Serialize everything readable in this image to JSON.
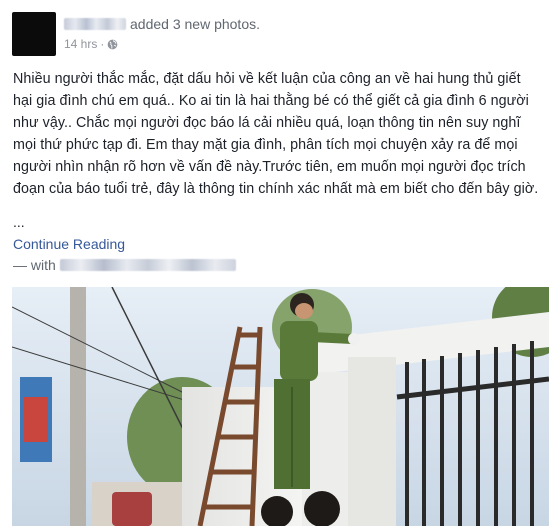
{
  "post": {
    "action_text": "added 3 new photos.",
    "time": "14 hrs",
    "separator": "·",
    "body": "Nhiều người thắc mắc, đặt dấu hỏi về kết luận của công an về hai hung thủ giết hại gia đình chú em quá.. Ko ai tin là hai thằng bé có thể giết cả gia đình 6 người như vậy.. Chắc mọi người đọc báo lá cải nhiều quá, loạn thông tin nên suy nghĩ mọi thứ phức tạp đi. Em thay mặt gia đình, phân tích mọi chuyện xảy ra để mọi người nhìn nhận rõ hơn về vấn đề này.Trước tiên, em muốn mọi người đọc trích đoạn của báo tuổi trẻ, đây là thông tin chính xác nhất mà em biết cho đến bây giờ.",
    "ellipsis": "...",
    "continue_label": "Continue Reading",
    "with_prefix": "— with"
  },
  "icons": {
    "privacy": "globe-icon"
  },
  "colors": {
    "link": "#365899",
    "meta": "#90949c",
    "text": "#1d2129"
  }
}
